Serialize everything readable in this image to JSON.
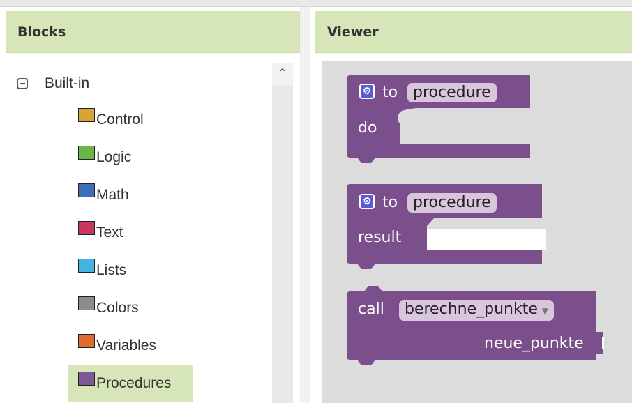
{
  "blocks_panel": {
    "header": "Blocks",
    "tree": {
      "root_label": "Built-in",
      "categories": [
        {
          "label": "Control",
          "color": "#d9a436"
        },
        {
          "label": "Logic",
          "color": "#6bb54a"
        },
        {
          "label": "Math",
          "color": "#3d6fb8"
        },
        {
          "label": "Text",
          "color": "#c8375b"
        },
        {
          "label": "Lists",
          "color": "#43b3e0"
        },
        {
          "label": "Colors",
          "color": "#8c8c8c"
        },
        {
          "label": "Variables",
          "color": "#e06b2c"
        },
        {
          "label": "Procedures",
          "color": "#7b5a93"
        }
      ],
      "selected": "Procedures"
    }
  },
  "viewer_panel": {
    "header": "Viewer",
    "block_color": "#7b4f8c",
    "blocks": {
      "proc_do": {
        "to_label": "to",
        "name": "procedure",
        "do_label": "do"
      },
      "proc_result": {
        "to_label": "to",
        "name": "procedure",
        "result_label": "result"
      },
      "call": {
        "call_label": "call",
        "name": "berechne_punkte",
        "arg_label": "neue_punkte"
      }
    }
  }
}
